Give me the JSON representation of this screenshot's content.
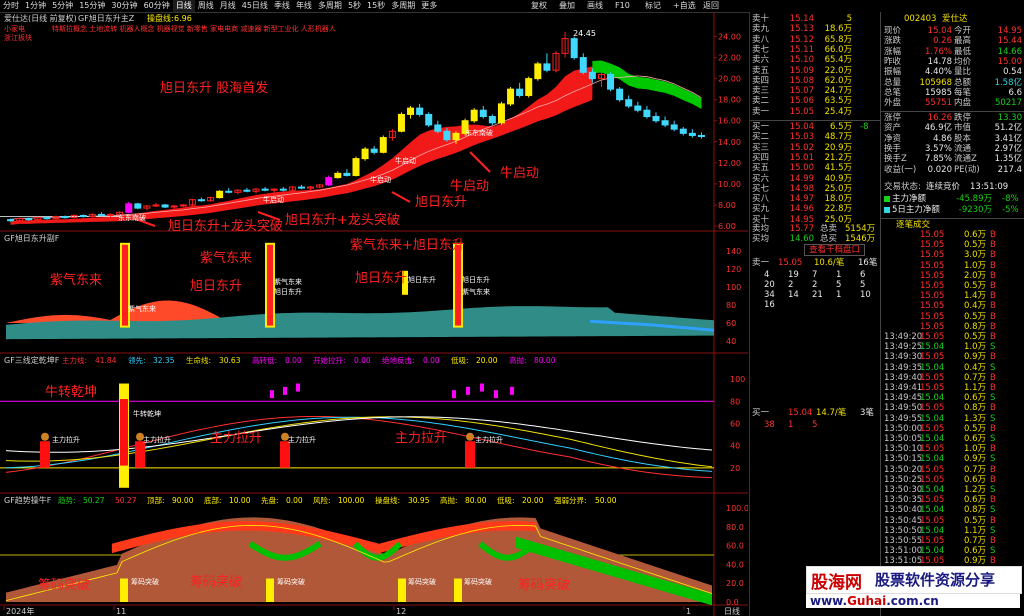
{
  "menu": {
    "periods": [
      "分时",
      "1分钟",
      "5分钟",
      "15分钟",
      "30分钟",
      "60分钟",
      "日线",
      "周线",
      "月线",
      "45日线",
      "季线",
      "年线",
      "多周期",
      "5秒",
      "15秒",
      "多周期",
      "更多"
    ],
    "selected_index": 6,
    "right_items": [
      "复权",
      "叠加",
      "画线",
      "F10",
      "标记",
      "+自选",
      "返回"
    ]
  },
  "main_panel": {
    "title": "爱仕达(日线 前复权)",
    "indicator": "GF旭日东升主Z",
    "indicator_val_label": "操盘线:",
    "indicator_val": "6.96",
    "price_max_label": "24.45",
    "scroll_text": "特斯拉概念  土地流转  机器人概念  机器视觉  新零售  家电电商  减速器  新型工业化  人形机器人",
    "side_tags": [
      "小家电",
      "浙江板块"
    ],
    "annotations": [
      {
        "text": "旭日东升  股海首发",
        "size": 13
      },
      {
        "text": "旭日东升+龙头突破",
        "size": 13
      },
      {
        "text": "旭日东升+龙头突破",
        "size": 13
      },
      {
        "text": "牛启动",
        "size": 13
      },
      {
        "text": "牛启动",
        "size": 13
      },
      {
        "text": "旭日东升",
        "size": 13
      }
    ],
    "small_labels": [
      "东东南破",
      "牛启动",
      "牛启动",
      "牛启动",
      "东东南破"
    ],
    "colors": {
      "ribbon_red": "#ff1a1a",
      "ribbon_green": "#00c800",
      "candle_up": "#ff2020",
      "candle_down": "#40d8ff",
      "yellow": "#ffee00",
      "magenta": "#ff00ff"
    }
  },
  "panel2": {
    "title": "GF旭日东升副F",
    "annotations": [
      {
        "text": "紫气东来"
      },
      {
        "text": "旭日东升"
      },
      {
        "text": "紫气东来"
      },
      {
        "text": "旭日东升"
      },
      {
        "text": "紫气东来+旭日东升"
      }
    ],
    "small_labels": [
      "紫气东来",
      "旭日东升",
      "紫气东来",
      "旭日东升",
      "旭日东升",
      "紫气东来"
    ],
    "axis": [
      "140",
      "120",
      "100",
      "80",
      "60",
      "40"
    ]
  },
  "panel3": {
    "title": "GF三线定乾坤F",
    "legend": [
      {
        "k": "主力线:",
        "v": "41.84",
        "c": "#ff3030"
      },
      {
        "k": "领先:",
        "v": "32.35",
        "c": "#30d0ff"
      },
      {
        "k": "生命线:",
        "v": "30.63",
        "c": "#f0e000"
      },
      {
        "k": "高转低:",
        "v": "0.00",
        "c": "#ff00ff"
      },
      {
        "k": "开始拉升:",
        "v": "0.00",
        "c": "#ff00ff"
      },
      {
        "k": "绝地反击:",
        "v": "0.00",
        "c": "#ff00ff"
      },
      {
        "k": "低吸:",
        "v": "20.00",
        "c": "#ffee00"
      },
      {
        "k": "高抛:",
        "v": "80.00",
        "c": "#ff00ff"
      }
    ],
    "annotations": [
      {
        "text": "牛转乾坤"
      },
      {
        "text": "主力拉升"
      },
      {
        "text": "主力拉升"
      }
    ],
    "small_labels": [
      "主力拉升",
      "牛转乾坤",
      "主力拉升",
      "主力拉升",
      "主力拉升"
    ],
    "axis": [
      "100",
      "80",
      "60",
      "40",
      "20"
    ]
  },
  "panel4": {
    "title": "GF趋势操牛F",
    "legend": [
      {
        "k": "趋势:",
        "v": "50.27",
        "c": "#18d018"
      },
      {
        "k": "",
        "v": "50.27",
        "c": "#ff3030"
      },
      {
        "k": "顶部:",
        "v": "90.00",
        "c": "#ffee00"
      },
      {
        "k": "底部:",
        "v": "10.00",
        "c": "#ffee00"
      },
      {
        "k": "先盘:",
        "v": "0.00",
        "c": "#ffee00"
      },
      {
        "k": "风险:",
        "v": "100.00",
        "c": "#ffee00"
      },
      {
        "k": "操盘线:",
        "v": "30.95",
        "c": "#ffee00"
      },
      {
        "k": "高抛:",
        "v": "80.00",
        "c": "#ffee00"
      },
      {
        "k": "低吸:",
        "v": "20.00",
        "c": "#ffee00"
      },
      {
        "k": "强弱分界:",
        "v": "50.00",
        "c": "#ffee00"
      }
    ],
    "annotations": [
      {
        "text": "筹码突破"
      },
      {
        "text": "筹码突破"
      },
      {
        "text": "筹码突破"
      }
    ],
    "small_labels": [
      "筹码突破",
      "筹码突破",
      "筹码突破",
      "筹码突破"
    ],
    "axis": [
      "100.0",
      "80.0",
      "60.0",
      "40.0",
      "20.0",
      "0.0"
    ]
  },
  "price_axis": [
    "24.00",
    "22.00",
    "20.00",
    "18.00",
    "16.00",
    "14.00",
    "12.00",
    "10.00",
    "8.00",
    "6.00"
  ],
  "time_axis": [
    {
      "t": "2024年"
    },
    {
      "t": "11"
    },
    {
      "t": "12"
    },
    {
      "t": "1"
    }
  ],
  "time_axis_right": "日线",
  "chart_data": {
    "type": "line",
    "title": "GF旭日东升主Z",
    "xlabel": "",
    "ylabel": "",
    "ylim": [
      6,
      25
    ],
    "note_ohlc": "approximate daily candles read from main panel",
    "ohlc": [
      [
        6.6,
        6.7,
        6.4,
        6.5
      ],
      [
        6.5,
        6.8,
        6.4,
        6.7
      ],
      [
        6.7,
        6.8,
        6.5,
        6.6
      ],
      [
        6.6,
        6.9,
        6.5,
        6.8
      ],
      [
        6.8,
        6.9,
        6.6,
        6.7
      ],
      [
        6.7,
        7.0,
        6.6,
        6.9
      ],
      [
        6.9,
        7.0,
        6.7,
        6.8
      ],
      [
        6.8,
        7.1,
        6.7,
        7.0
      ],
      [
        7.0,
        7.1,
        6.8,
        6.9
      ],
      [
        6.9,
        7.2,
        6.8,
        7.1
      ],
      [
        7.1,
        7.3,
        6.9,
        7.0
      ],
      [
        7.0,
        7.2,
        6.8,
        7.1
      ],
      [
        7.1,
        7.4,
        7.0,
        7.3
      ],
      [
        7.3,
        8.3,
        7.2,
        8.1
      ],
      [
        8.1,
        8.2,
        7.6,
        7.7
      ],
      [
        7.7,
        8.0,
        7.5,
        7.9
      ],
      [
        7.9,
        8.2,
        7.8,
        8.0
      ],
      [
        8.0,
        8.1,
        7.7,
        7.8
      ],
      [
        7.8,
        8.0,
        7.6,
        7.9
      ],
      [
        7.9,
        8.1,
        7.8,
        8.0
      ],
      [
        8.0,
        8.6,
        7.9,
        8.5
      ],
      [
        8.5,
        8.7,
        8.3,
        8.4
      ],
      [
        8.4,
        8.8,
        8.3,
        8.7
      ],
      [
        8.7,
        9.4,
        8.6,
        9.3
      ],
      [
        9.3,
        9.6,
        9.1,
        9.2
      ],
      [
        9.2,
        9.5,
        9.0,
        9.4
      ],
      [
        9.4,
        9.6,
        9.2,
        9.3
      ],
      [
        9.3,
        9.6,
        9.1,
        9.5
      ],
      [
        9.5,
        9.7,
        9.3,
        9.4
      ],
      [
        9.4,
        9.6,
        9.2,
        9.5
      ],
      [
        9.5,
        9.7,
        9.3,
        9.4
      ],
      [
        9.4,
        9.8,
        9.3,
        9.7
      ],
      [
        9.7,
        9.9,
        9.5,
        9.6
      ],
      [
        9.6,
        9.8,
        9.4,
        9.7
      ],
      [
        9.7,
        10.0,
        9.6,
        9.9
      ],
      [
        9.9,
        10.8,
        9.8,
        10.6
      ],
      [
        10.6,
        11.2,
        10.5,
        11.0
      ],
      [
        11.0,
        11.4,
        10.7,
        10.8
      ],
      [
        10.8,
        12.6,
        10.7,
        12.4
      ],
      [
        12.4,
        13.5,
        12.2,
        13.3
      ],
      [
        13.3,
        13.6,
        12.8,
        13.0
      ],
      [
        13.0,
        14.6,
        12.9,
        14.4
      ],
      [
        14.4,
        15.2,
        14.1,
        15.0
      ],
      [
        15.0,
        16.8,
        14.9,
        16.6
      ],
      [
        16.6,
        17.4,
        16.2,
        17.2
      ],
      [
        17.2,
        17.6,
        16.4,
        16.6
      ],
      [
        16.6,
        16.8,
        15.4,
        15.6
      ],
      [
        15.6,
        16.0,
        14.8,
        15.0
      ],
      [
        15.0,
        15.3,
        14.0,
        14.2
      ],
      [
        14.2,
        15.0,
        13.8,
        14.8
      ],
      [
        14.8,
        16.2,
        14.6,
        16.0
      ],
      [
        16.0,
        17.2,
        15.8,
        17.0
      ],
      [
        17.0,
        17.4,
        16.2,
        16.4
      ],
      [
        16.4,
        16.6,
        15.6,
        15.8
      ],
      [
        15.8,
        17.8,
        15.6,
        17.6
      ],
      [
        17.6,
        19.2,
        17.4,
        19.0
      ],
      [
        19.0,
        19.6,
        18.2,
        18.4
      ],
      [
        18.4,
        20.2,
        18.2,
        20.0
      ],
      [
        20.0,
        21.6,
        19.8,
        21.4
      ],
      [
        21.4,
        22.4,
        20.6,
        20.8
      ],
      [
        20.8,
        22.6,
        20.6,
        22.4
      ],
      [
        22.4,
        24.45,
        22.0,
        23.8
      ],
      [
        23.8,
        24.0,
        21.8,
        22.0
      ],
      [
        22.0,
        22.4,
        20.4,
        20.6
      ],
      [
        20.6,
        21.0,
        19.6,
        20.0
      ],
      [
        20.0,
        20.6,
        19.2,
        20.4
      ],
      [
        20.4,
        20.6,
        18.8,
        19.0
      ],
      [
        19.0,
        19.2,
        17.8,
        18.0
      ],
      [
        18.0,
        18.4,
        17.2,
        17.4
      ],
      [
        17.4,
        17.8,
        16.8,
        17.0
      ],
      [
        17.0,
        17.4,
        16.2,
        16.4
      ],
      [
        16.4,
        16.8,
        15.8,
        16.0
      ],
      [
        16.0,
        16.4,
        15.4,
        15.6
      ],
      [
        15.6,
        16.0,
        15.0,
        15.2
      ],
      [
        15.2,
        15.4,
        14.6,
        14.8
      ],
      [
        14.8,
        15.2,
        14.4,
        14.6
      ],
      [
        14.6,
        14.9,
        14.3,
        14.5
      ]
    ],
    "series": []
  },
  "quote": {
    "code": "002403",
    "name": "爱仕达",
    "sell": [
      {
        "k": "卖十",
        "p": "15.14",
        "v": "5"
      },
      {
        "k": "卖九",
        "p": "15.13",
        "v": "18.6万"
      },
      {
        "k": "卖八",
        "p": "15.12",
        "v": "65.8万"
      },
      {
        "k": "卖七",
        "p": "15.11",
        "v": "66.0万"
      },
      {
        "k": "卖六",
        "p": "15.10",
        "v": "65.4万"
      },
      {
        "k": "卖五",
        "p": "15.09",
        "v": "22.0万"
      },
      {
        "k": "卖四",
        "p": "15.08",
        "v": "62.0万"
      },
      {
        "k": "卖三",
        "p": "15.07",
        "v": "24.7万"
      },
      {
        "k": "卖二",
        "p": "15.06",
        "v": "63.5万"
      },
      {
        "k": "卖一",
        "p": "15.05",
        "v": "25.4万"
      }
    ],
    "buy": [
      {
        "k": "买一",
        "p": "15.04",
        "v": "6.5万",
        "x": "-8"
      },
      {
        "k": "买二",
        "p": "15.03",
        "v": "48.7万",
        "x": ""
      },
      {
        "k": "买三",
        "p": "15.02",
        "v": "20.9万",
        "x": ""
      },
      {
        "k": "买四",
        "p": "15.01",
        "v": "21.2万",
        "x": ""
      },
      {
        "k": "买五",
        "p": "15.00",
        "v": "41.5万",
        "x": ""
      },
      {
        "k": "买六",
        "p": "14.99",
        "v": "40.9万",
        "x": ""
      },
      {
        "k": "买七",
        "p": "14.98",
        "v": "25.0万",
        "x": ""
      },
      {
        "k": "买八",
        "p": "14.97",
        "v": "18.0万",
        "x": ""
      },
      {
        "k": "买九",
        "p": "14.96",
        "v": "22.8万",
        "x": ""
      },
      {
        "k": "买十",
        "p": "14.95",
        "v": "25.0万",
        "x": ""
      }
    ],
    "avg_sell": {
      "k": "卖均",
      "p": "15.77",
      "k2": "总卖",
      "v": "5154万"
    },
    "avg_buy": {
      "k": "买均",
      "p": "14.60",
      "k2": "总买",
      "v": "1546万"
    },
    "qianfang_btn": "查看千档盘口",
    "queue_sell_head": {
      "k": "卖一",
      "p": "15.05",
      "q": "10.6/笔",
      "n": "16笔"
    },
    "queue_sell_rows": [
      [
        "4",
        "19",
        "7",
        "1",
        "6"
      ],
      [
        "20",
        "2",
        "2",
        "5",
        "5"
      ],
      [
        "34",
        "14",
        "21",
        "1",
        "10"
      ],
      [
        "16",
        "",
        "",
        "",
        ""
      ]
    ],
    "queue_buy_head": {
      "k": "买一",
      "p": "15.04",
      "q": "14.7/笔",
      "n": "3笔"
    },
    "queue_buy_rows": [
      [
        "38",
        "1",
        "5",
        "",
        ""
      ]
    ],
    "stats_left": [
      {
        "k": "现价",
        "v": "15.04",
        "c": "red"
      },
      {
        "k": "涨跌",
        "v": "0.26",
        "c": "red"
      },
      {
        "k": "涨幅",
        "v": "1.76%",
        "c": "red"
      },
      {
        "k": "昨收",
        "v": "14.78",
        "c": "wht"
      },
      {
        "k": "振幅",
        "v": "4.40%",
        "c": "wht"
      },
      {
        "k": "总量",
        "v": "105968",
        "c": "yel"
      },
      {
        "k": "总笔",
        "v": "15985",
        "c": "wht"
      },
      {
        "k": "外盘",
        "v": "55751",
        "c": "red"
      }
    ],
    "stats_right": [
      {
        "k": "今开",
        "v": "14.95",
        "c": "red"
      },
      {
        "k": "最高",
        "v": "15.44",
        "c": "red"
      },
      {
        "k": "最低",
        "v": "14.66",
        "c": "grn"
      },
      {
        "k": "均价",
        "v": "15.00",
        "c": "red"
      },
      {
        "k": "量比",
        "v": "0.54",
        "c": "wht"
      },
      {
        "k": "总额",
        "v": "1.58亿",
        "c": "cyn"
      },
      {
        "k": "每笔",
        "v": "6.6",
        "c": "wht"
      },
      {
        "k": "内盘",
        "v": "50217",
        "c": "grn"
      }
    ],
    "stats2_left": [
      {
        "k": "涨停",
        "v": "16.26",
        "c": "red"
      },
      {
        "k": "资产",
        "v": "46.9亿",
        "c": "wht"
      },
      {
        "k": "净资",
        "v": "4.86",
        "c": "wht"
      },
      {
        "k": "换手",
        "v": "3.57%",
        "c": "wht"
      },
      {
        "k": "换手Z",
        "v": "7.85%",
        "c": "wht"
      },
      {
        "k": "收益(一)",
        "v": "0.020",
        "c": "wht"
      }
    ],
    "stats2_right": [
      {
        "k": "跌停",
        "v": "13.30",
        "c": "grn"
      },
      {
        "k": "市值",
        "v": "51.2亿",
        "c": "wht"
      },
      {
        "k": "股本",
        "v": "3.41亿",
        "c": "wht"
      },
      {
        "k": "流通",
        "v": "2.97亿",
        "c": "wht"
      },
      {
        "k": "流通Z",
        "v": "1.35亿",
        "c": "wht"
      },
      {
        "k": "PE(动)",
        "v": "217.4",
        "c": "wht"
      }
    ],
    "trade_status_label": "交易状态:",
    "trade_status": "连续竞价",
    "trade_time": "13:51:09",
    "flow": [
      {
        "k": "主力净额",
        "v": "-45.89万",
        "p": "-8%"
      },
      {
        "k": "5日主力净额",
        "v": "-9230万",
        "p": "-5%"
      }
    ],
    "ticks_header": "逐笔成交",
    "ticks": [
      {
        "t": "",
        "p": "15.05",
        "v": "0.6万",
        "d": "B"
      },
      {
        "t": "",
        "p": "15.05",
        "v": "0.5万",
        "d": "B"
      },
      {
        "t": "",
        "p": "15.05",
        "v": "3.0万",
        "d": "B"
      },
      {
        "t": "",
        "p": "15.05",
        "v": "1.0万",
        "d": "B"
      },
      {
        "t": "",
        "p": "15.05",
        "v": "2.0万",
        "d": "B"
      },
      {
        "t": "",
        "p": "15.05",
        "v": "0.5万",
        "d": "B"
      },
      {
        "t": "",
        "p": "15.05",
        "v": "1.4万",
        "d": "B"
      },
      {
        "t": "",
        "p": "15.05",
        "v": "0.4万",
        "d": "B"
      },
      {
        "t": "",
        "p": "15.05",
        "v": "0.5万",
        "d": "B"
      },
      {
        "t": "",
        "p": "15.05",
        "v": "0.8万",
        "d": "B"
      },
      {
        "t": "13:49:20",
        "p": "15.05",
        "v": "0.5万",
        "d": "B"
      },
      {
        "t": "13:49:25",
        "p": "15.04",
        "v": "1.0万",
        "d": "S"
      },
      {
        "t": "13:49:30",
        "p": "15.05",
        "v": "0.9万",
        "d": "B"
      },
      {
        "t": "13:49:35",
        "p": "15.04",
        "v": "0.4万",
        "d": "S"
      },
      {
        "t": "13:49:40",
        "p": "15.05",
        "v": "0.7万",
        "d": "B"
      },
      {
        "t": "13:49:41",
        "p": "15.05",
        "v": "1.1万",
        "d": "B"
      },
      {
        "t": "13:49:45",
        "p": "15.04",
        "v": "0.6万",
        "d": "S"
      },
      {
        "t": "13:49:50",
        "p": "15.05",
        "v": "0.8万",
        "d": "B"
      },
      {
        "t": "13:49:55",
        "p": "15.04",
        "v": "1.3万",
        "d": "S"
      },
      {
        "t": "13:50:00",
        "p": "15.05",
        "v": "0.5万",
        "d": "B"
      },
      {
        "t": "13:50:05",
        "p": "15.04",
        "v": "0.6万",
        "d": "S"
      },
      {
        "t": "13:50:10",
        "p": "15.05",
        "v": "1.0万",
        "d": "B"
      },
      {
        "t": "13:50:15",
        "p": "15.04",
        "v": "0.9万",
        "d": "S"
      },
      {
        "t": "13:50:20",
        "p": "15.05",
        "v": "0.7万",
        "d": "B"
      },
      {
        "t": "13:50:25",
        "p": "15.05",
        "v": "0.6万",
        "d": "B"
      },
      {
        "t": "13:50:30",
        "p": "15.04",
        "v": "1.2万",
        "d": "S"
      },
      {
        "t": "13:50:35",
        "p": "15.05",
        "v": "0.6万",
        "d": "B"
      },
      {
        "t": "13:50:40",
        "p": "15.04",
        "v": "0.8万",
        "d": "S"
      },
      {
        "t": "13:50:45",
        "p": "15.05",
        "v": "0.5万",
        "d": "B"
      },
      {
        "t": "13:50:50",
        "p": "15.04",
        "v": "1.1万",
        "d": "S"
      },
      {
        "t": "13:50:55",
        "p": "15.05",
        "v": "0.7万",
        "d": "B"
      },
      {
        "t": "13:51:00",
        "p": "15.04",
        "v": "0.6万",
        "d": "S"
      },
      {
        "t": "13:51:05",
        "p": "15.05",
        "v": "0.9万",
        "d": "B"
      },
      {
        "t": "13:51:09",
        "p": "15.04",
        "v": "0.5万",
        "d": "S"
      }
    ]
  },
  "watermark": {
    "a": "股海网",
    "b": "股票软件资源分享",
    "url_a": "www.",
    "url_b": "Guhai",
    "url_c": ".com.cn"
  }
}
